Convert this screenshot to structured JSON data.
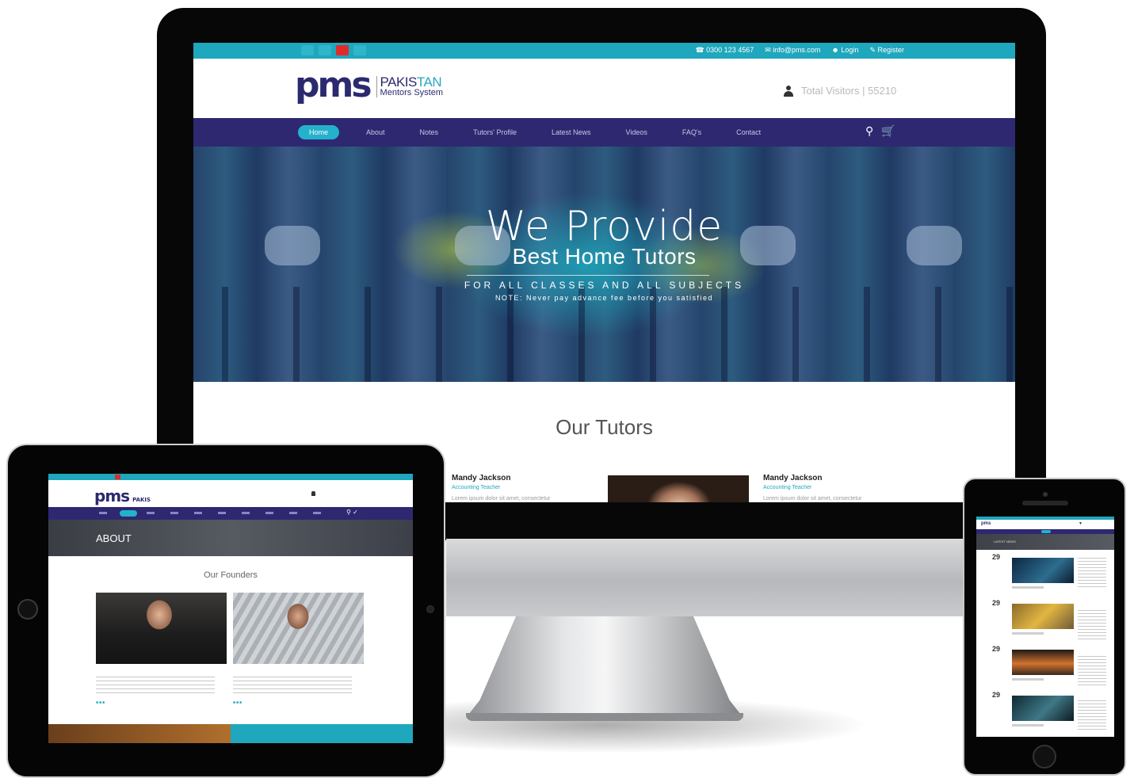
{
  "desktop": {
    "topbar": {
      "phone": "0300 123 4567",
      "email": "info@pms.com",
      "login": "Login",
      "register": "Register"
    },
    "logo": {
      "mark_a": "p",
      "mark_b": "ms",
      "word_a": "PAKIS",
      "word_b": "TAN",
      "word_c": "Mentors System"
    },
    "visitors": "Total Visitors | 55210",
    "nav": {
      "items": [
        "Home",
        "About",
        "Notes",
        "Tutors' Profile",
        "Latest News",
        "Videos",
        "FAQ's",
        "Contact"
      ]
    },
    "hero": {
      "line1": "We Provide",
      "line2": "Best Home Tutors",
      "line3": "FOR ALL CLASSES AND ALL SUBJECTS",
      "line4": "NOTE: Never pay advance fee before you satisfied"
    },
    "section_title": "Our Tutors",
    "tutors": [
      {
        "name": "Mandy Jackson",
        "subject": "Accounting Teacher",
        "text": "Lorem ipsum dolor sit amet, consectetur"
      },
      {
        "name": "Mandy Jackson",
        "subject": "Accounting Teacher",
        "text": "Lorem ipsum dolor sit amet, consectetur"
      }
    ]
  },
  "tablet": {
    "banner_title": "ABOUT",
    "section_title": "Our Founders"
  },
  "phone": {
    "banner_title": "LATEST NEWS",
    "dates": [
      "29",
      "29",
      "29",
      "29"
    ]
  },
  "colors": {
    "teal": "#1fa7bd",
    "navy": "#2e2871",
    "youtube": "#e12a2a"
  },
  "icons": [
    "phone-icon",
    "mail-icon",
    "user-icon",
    "pencil-icon",
    "search-icon",
    "cart-icon",
    "youtube-icon"
  ]
}
